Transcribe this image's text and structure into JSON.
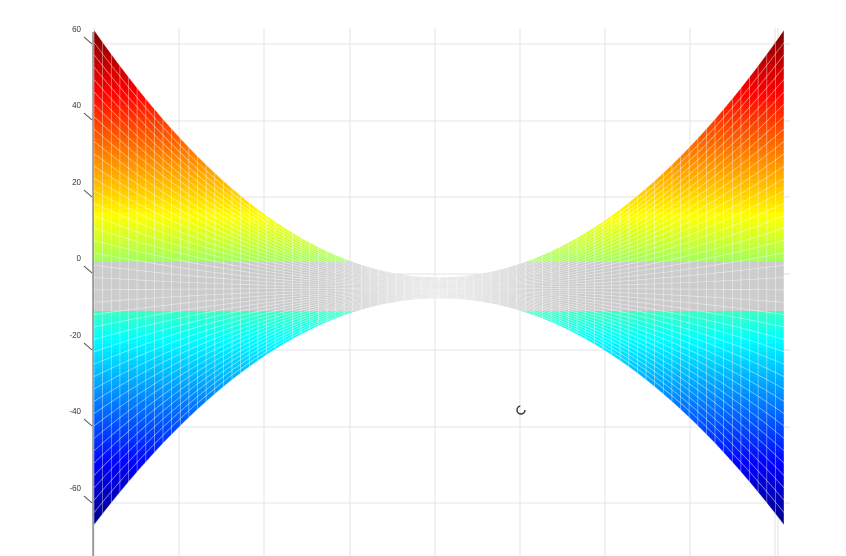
{
  "chart_data": {
    "type": "surface",
    "title": "",
    "xlabel": "",
    "ylabel": "",
    "zlim": [
      -60,
      60
    ],
    "z_ticks": [
      "60",
      "40",
      "20",
      "0",
      "-20",
      "-40",
      "-60"
    ],
    "surface": "saddle (hyperbolic paraboloid) viewed from the side",
    "z_at_edges": {
      "left_max": 60,
      "left_min": -60,
      "right_max": 60,
      "right_min": -60
    },
    "z_at_center": {
      "upper": 0,
      "lower": -5
    },
    "colormap": "jet",
    "flat_color_band": [
      -8,
      4
    ],
    "flat_color": "#cccccc",
    "grid": true
  },
  "cursor": {
    "icon": "busy-cursor-icon"
  }
}
